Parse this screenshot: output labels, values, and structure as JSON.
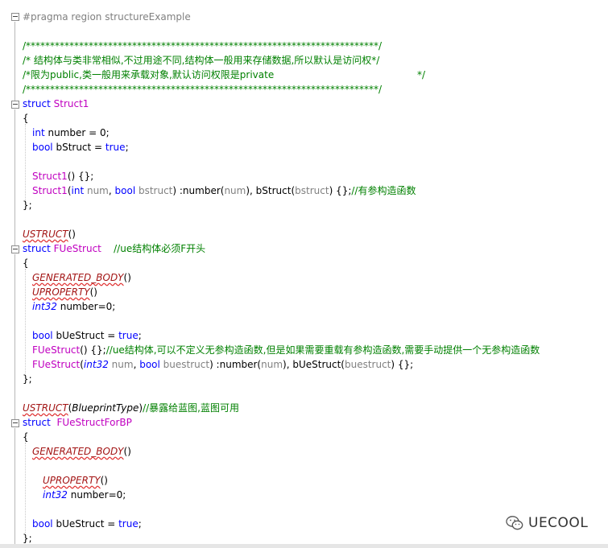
{
  "lines": {
    "l0": "#pragma region structureExample",
    "l1": "/*************************************************************************/",
    "l2": "/* 结构体与类非常相似,不过用途不同,结构体一般用来存储数据,所以默认是访问权*/",
    "l3a": "/*限为public,类一般用来承载对象,默认访问权限是private",
    "l3b": "*/",
    "l4": "/*************************************************************************/",
    "struct_kw": "struct",
    "s1_name": "Struct1",
    "brace_open": "{",
    "brace_close": "};",
    "s1_f1_type": "int",
    "s1_f1_rest": " number = 0;",
    "s1_f2_type": "bool",
    "s1_f2_rest": " bStruct = ",
    "true_kw": "true",
    "semicolon": ";",
    "s1_ctor1_name": "Struct1",
    "s1_ctor1_rest": "() {};",
    "s1_ctor2_name": "Struct1",
    "s1_ctor2_p1": "(",
    "s1_ctor2_int": "int",
    "s1_ctor2_num": " num",
    "s1_ctor2_comma": ", ",
    "s1_ctor2_bool": "bool",
    "s1_ctor2_bstruct": " bstruct",
    "s1_ctor2_mid": ") :number(",
    "s1_ctor2_num2": "num",
    "s1_ctor2_mid2": "), bStruct(",
    "s1_ctor2_bstruct2": "bstruct",
    "s1_ctor2_end": ") {};",
    "s1_ctor2_comment": "//有参构造函数",
    "ustruct": "USTRUCT",
    "paren_pair": "()",
    "s2_name": "FUeStruct",
    "s2_comment": "//ue结构体必须F开头",
    "generated_body": "GENERATED_BODY",
    "uproperty": "UPROPERTY",
    "int32": "int32",
    "number_zero": " number=0;",
    "bool_kw": "bool",
    "buestruct_decl": " bUeStruct = ",
    "s2_ctor1_name": "FUeStruct",
    "s2_ctor1_rest": "() {};",
    "s2_ctor1_comment": "//ue结构体,可以不定义无参构造函数,但是如果需要重载有参构造函数,需要手动提供一个无参构造函数",
    "s2_ctor2_name": "FUeStruct",
    "s2_ctor2_p1": "(",
    "s2_ctor2_num": " num",
    "s2_ctor2_comma": ", ",
    "s2_ctor2_buestruct": " buestruct",
    "s2_ctor2_mid": ") :number(",
    "s2_ctor2_num2": "num",
    "s2_ctor2_mid2": "), bUeStruct(",
    "s2_ctor2_buestruct2": "buestruct",
    "s2_ctor2_end": ") {};",
    "ustruct_bp_open": "(",
    "blueprint_type": "BlueprintType",
    "ustruct_bp_close": ")",
    "ustruct_bp_comment": "//暴露给蓝图,蓝图可用",
    "s3_name": "FUeStructForBP"
  },
  "watermark": {
    "text": "UECOOL",
    "icon": "wechat-icon"
  },
  "colors": {
    "keyword": "#0000ff",
    "type": "#c000c0",
    "comment": "#008000",
    "param": "#808080",
    "macro": "#a31515"
  }
}
